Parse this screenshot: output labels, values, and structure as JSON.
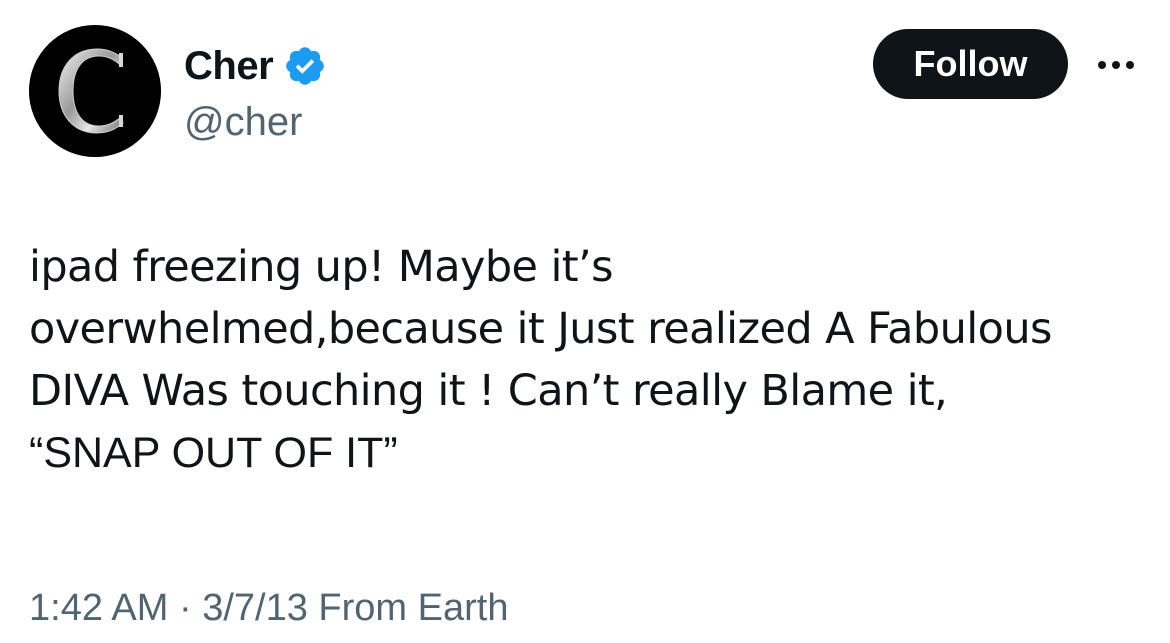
{
  "author": {
    "display_name": "Cher",
    "handle": "@cher",
    "avatar_letter": "C",
    "verified_icon": "verified-badge-icon",
    "verified_color": "#1d9bf0"
  },
  "actions": {
    "follow_label": "Follow",
    "more_icon": "more-options-icon"
  },
  "tweet": {
    "lines": [
      "ipad freezing up! Maybe it’s",
      "overwhelmed,because it Just realized A Fabulous",
      "DIVA Was touching it ! Can’t really Blame it,",
      "“SNAP OUT OF IT”"
    ]
  },
  "meta": {
    "time": "1:42 AM",
    "separator": " · ",
    "date": "3/7/13",
    "source": " From Earth"
  },
  "colors": {
    "text": "#0f1419",
    "secondary_text": "#536471",
    "follow_bg": "#0f1419",
    "follow_text": "#ffffff",
    "background": "#ffffff"
  }
}
